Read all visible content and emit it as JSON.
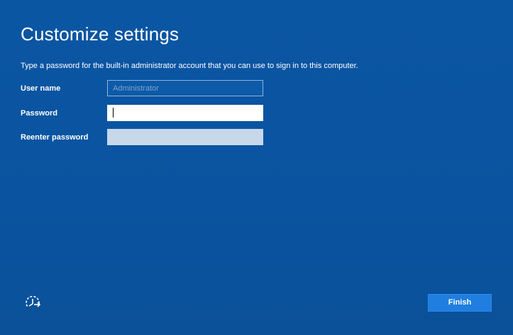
{
  "page": {
    "title": "Customize settings",
    "instructions": "Type a password for the built-in administrator account that you can use to sign in to this computer."
  },
  "form": {
    "user_name": {
      "label": "User name",
      "value": "",
      "placeholder": "Administrator",
      "state": "disabled"
    },
    "password": {
      "label": "Password",
      "value": "",
      "state": "focused"
    },
    "reenter_password": {
      "label": "Reenter password",
      "value": "",
      "state": "inactive"
    }
  },
  "footer": {
    "ease_of_access_icon": "ease-of-access-icon",
    "finish_label": "Finish"
  },
  "colors": {
    "background": "#0a54a0",
    "button": "#1f7ee0",
    "text": "#ffffff"
  }
}
